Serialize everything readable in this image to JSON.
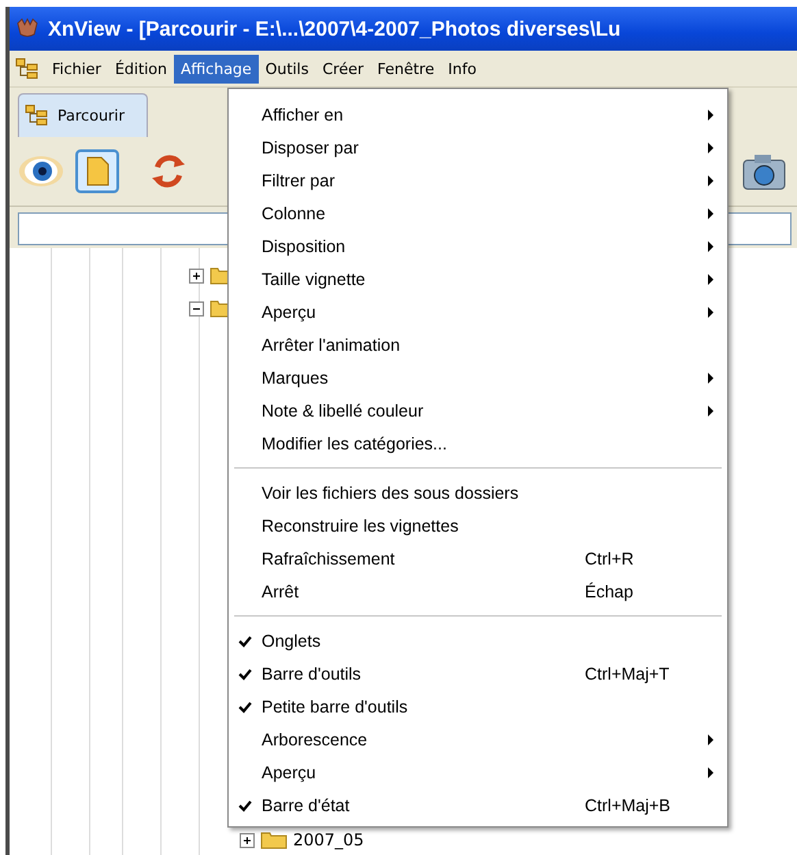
{
  "window": {
    "title": "XnView - [Parcourir - E:\\...\\2007\\4-2007_Photos diverses\\Lu"
  },
  "menubar": [
    {
      "label": "Fichier",
      "selected": false
    },
    {
      "label": "Édition",
      "selected": false
    },
    {
      "label": "Affichage",
      "selected": true
    },
    {
      "label": "Outils",
      "selected": false
    },
    {
      "label": "Créer",
      "selected": false
    },
    {
      "label": "Fenêtre",
      "selected": false
    },
    {
      "label": "Info",
      "selected": false
    }
  ],
  "tabs": [
    {
      "label": "Parcourir",
      "selected": true
    }
  ],
  "tree": {
    "items": [
      {
        "expanded": false
      },
      {
        "expanded": true,
        "children": [
          {
            "label": "2007_05",
            "expanded": false
          }
        ]
      }
    ]
  },
  "menu": {
    "sections": [
      {
        "items": [
          {
            "label": "Afficher en",
            "checked": false,
            "submenu": true
          },
          {
            "label": "Disposer par",
            "checked": false,
            "submenu": true
          },
          {
            "label": "Filtrer par",
            "checked": false,
            "submenu": true
          },
          {
            "label": "Colonne",
            "checked": false,
            "submenu": true
          },
          {
            "label": "Disposition",
            "checked": false,
            "submenu": true
          },
          {
            "label": "Taille vignette",
            "checked": false,
            "submenu": true
          },
          {
            "label": "Aperçu",
            "checked": false,
            "submenu": true
          },
          {
            "label": "Arrêter l'animation",
            "checked": false,
            "submenu": false
          },
          {
            "label": "Marques",
            "checked": false,
            "submenu": true
          },
          {
            "label": "Note & libellé couleur",
            "checked": false,
            "submenu": true
          },
          {
            "label": "Modifier les catégories...",
            "checked": false,
            "submenu": false
          }
        ]
      },
      {
        "items": [
          {
            "label": "Voir les fichiers des sous dossiers",
            "checked": false,
            "submenu": false
          },
          {
            "label": "Reconstruire les vignettes",
            "checked": false,
            "submenu": false
          },
          {
            "label": "Rafraîchissement",
            "checked": false,
            "submenu": false,
            "shortcut": "Ctrl+R"
          },
          {
            "label": "Arrêt",
            "checked": false,
            "submenu": false,
            "shortcut": "Échap"
          }
        ]
      },
      {
        "items": [
          {
            "label": "Onglets",
            "checked": true,
            "submenu": false
          },
          {
            "label": "Barre d'outils",
            "checked": true,
            "submenu": false,
            "shortcut": "Ctrl+Maj+T"
          },
          {
            "label": "Petite barre d'outils",
            "checked": true,
            "submenu": false
          },
          {
            "label": "Arborescence",
            "checked": false,
            "submenu": true
          },
          {
            "label": "Aperçu",
            "checked": false,
            "submenu": true
          },
          {
            "label": "Barre d'état",
            "checked": true,
            "submenu": false,
            "shortcut": "Ctrl+Maj+B"
          }
        ]
      }
    ]
  }
}
